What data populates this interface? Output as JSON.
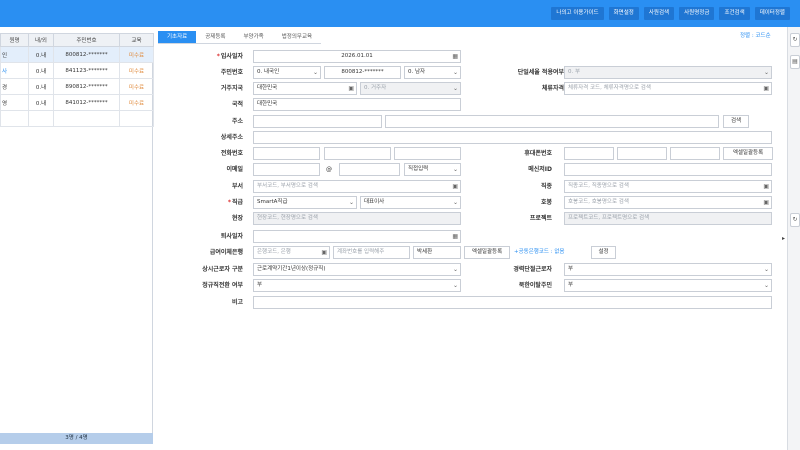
{
  "topbar": {
    "buttons": [
      "나의고 이용가이드",
      "화면설정",
      "사원검색",
      "사원명정금",
      "조건검색",
      "데이터정렬"
    ]
  },
  "employee_table": {
    "headers": [
      "원명",
      "내/외",
      "주민번호",
      "교육"
    ],
    "rows": [
      {
        "name": "인",
        "type": "0.내",
        "ssn": "800812-*******",
        "edu": "미수료"
      },
      {
        "name": "사",
        "type": "0.내",
        "ssn": "841123-*******",
        "edu": "미수료"
      },
      {
        "name": "경",
        "type": "0.내",
        "ssn": "890812-*******",
        "edu": "미수료"
      },
      {
        "name": "영",
        "type": "0.내",
        "ssn": "841012-*******",
        "edu": "미수료"
      }
    ],
    "footer": "3명 / 4명"
  },
  "tabs": [
    "기초자료",
    "공제등록",
    "부양가족",
    "법정의무교육"
  ],
  "sort_link": "정렬 : 코드순",
  "form": {
    "hire_date": {
      "label": "입사일자",
      "value": "2026.01.01"
    },
    "ssn": {
      "label": "주민번호",
      "nation_type": "0. 내국인",
      "value": "800812-*******",
      "gender": "0. 남자"
    },
    "single_tax": {
      "label": "단일세율 적용여부",
      "value": "0. 부"
    },
    "residence_country": {
      "label": "거주지국",
      "value": "대한민국",
      "resident": "0. 거주자"
    },
    "visa": {
      "label": "체류자격",
      "placeholder": "체류자격 코드, 체류자격명으로 검색"
    },
    "nationality": {
      "label": "국적",
      "value": "대한민국"
    },
    "address": {
      "label": "주소",
      "search_btn": "검색"
    },
    "address_detail": {
      "label": "상세주소"
    },
    "phone": {
      "label": "전화번호"
    },
    "mobile": {
      "label": "휴대폰번호",
      "btn": "엑셀일괄등록"
    },
    "email": {
      "label": "이메일",
      "at": "@",
      "direct": "직접입력"
    },
    "messenger": {
      "label": "메신저ID"
    },
    "dept": {
      "label": "부서",
      "placeholder": "부서코드, 부서명으로 검색"
    },
    "job": {
      "label": "직종",
      "placeholder": "직종코드, 직종명으로 검색"
    },
    "position": {
      "label": "직급",
      "value": "SmartA직급",
      "title": "대표이사"
    },
    "rank": {
      "label": "호봉",
      "placeholder": "호봉코드, 호봉명으로 검색"
    },
    "site": {
      "label": "현장",
      "placeholder": "현장코드, 현장명으로 검색"
    },
    "project": {
      "label": "프로젝트",
      "placeholder": "프로젝트코드, 프로젝트명으로 검색"
    },
    "leave_date": {
      "label": "퇴사일자"
    },
    "bank": {
      "label": "급여이체은행",
      "bank_ph": "은행코드, 은행",
      "account_ph": "계좌번호를 입력해주",
      "holder": "박세환",
      "excel_btn": "엑셀일괄등록",
      "common_bank": "+공동은행코드 : 없음",
      "setup_btn": "설정"
    },
    "regular_worker": {
      "label": "상시근로자 구분",
      "value": "근로계약기간1년이상(정규직)"
    },
    "severe_disabled": {
      "label": "경력단절근로자",
      "value": "부"
    },
    "regular_conversion": {
      "label": "정규직전환 여부",
      "value": "부"
    },
    "north_defector": {
      "label": "북한이탈주민",
      "value": "부"
    },
    "note": {
      "label": "비고"
    }
  },
  "colors": {
    "accent": "#2a8ff2",
    "required": "#d33333",
    "edu_status": "#e08a3c"
  }
}
